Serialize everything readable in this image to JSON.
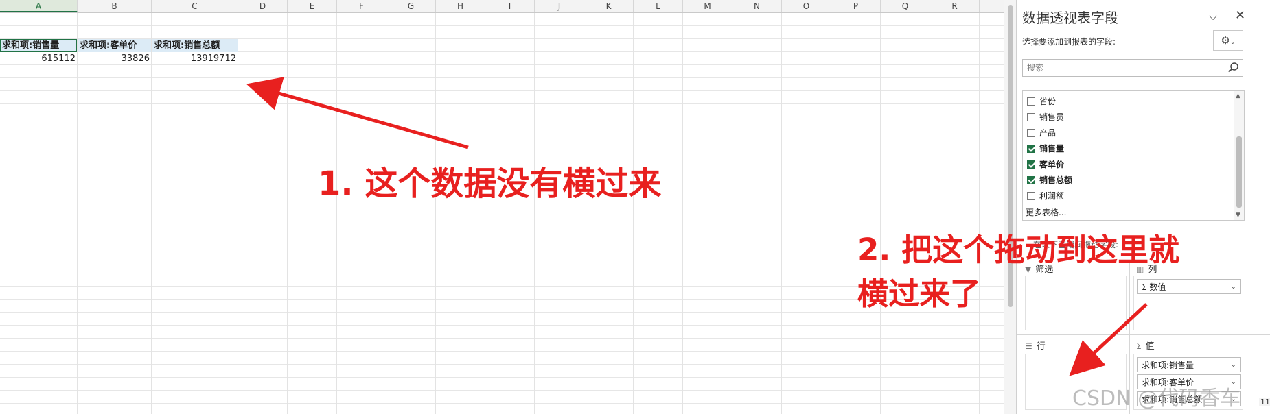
{
  "sheet": {
    "columns": [
      "A",
      "B",
      "C",
      "D",
      "E",
      "F",
      "G",
      "H",
      "I",
      "J",
      "K",
      "L",
      "M",
      "N",
      "O",
      "P",
      "Q",
      "R"
    ],
    "active_column": "A",
    "headers": [
      "求和项:销售量",
      "求和项:客单价",
      "求和项:销售总额"
    ],
    "values": [
      "615112",
      "33826",
      "13919712"
    ]
  },
  "pivot_pane": {
    "title": "数据透视表字段",
    "subtitle": "选择要添加到报表的字段:",
    "search_placeholder": "搜索",
    "fields": [
      {
        "label": "省份",
        "checked": false
      },
      {
        "label": "销售员",
        "checked": false
      },
      {
        "label": "产品",
        "checked": false
      },
      {
        "label": "销售量",
        "checked": true
      },
      {
        "label": "客单价",
        "checked": true
      },
      {
        "label": "销售总额",
        "checked": true
      },
      {
        "label": "利润额",
        "checked": false
      }
    ],
    "more_tables": "更多表格...",
    "drag_hint": "在以下区域间拖动字段:",
    "areas": {
      "filter_label": "筛选",
      "columns_label": "列",
      "rows_label": "行",
      "values_label": "值",
      "columns_items": [
        "Σ 数值"
      ],
      "values_items": [
        "求和项:销售量",
        "求和项:客单价",
        "求和项:销售总额"
      ]
    }
  },
  "annotations": {
    "note1": "1. 这个数据没有横过来",
    "note2_line1": "2. 把这个拖动到这里就",
    "note2_line2": "横过来了",
    "color": "#e8201f"
  },
  "watermark": "CSDN @代码香车",
  "zoom_tag": "11"
}
